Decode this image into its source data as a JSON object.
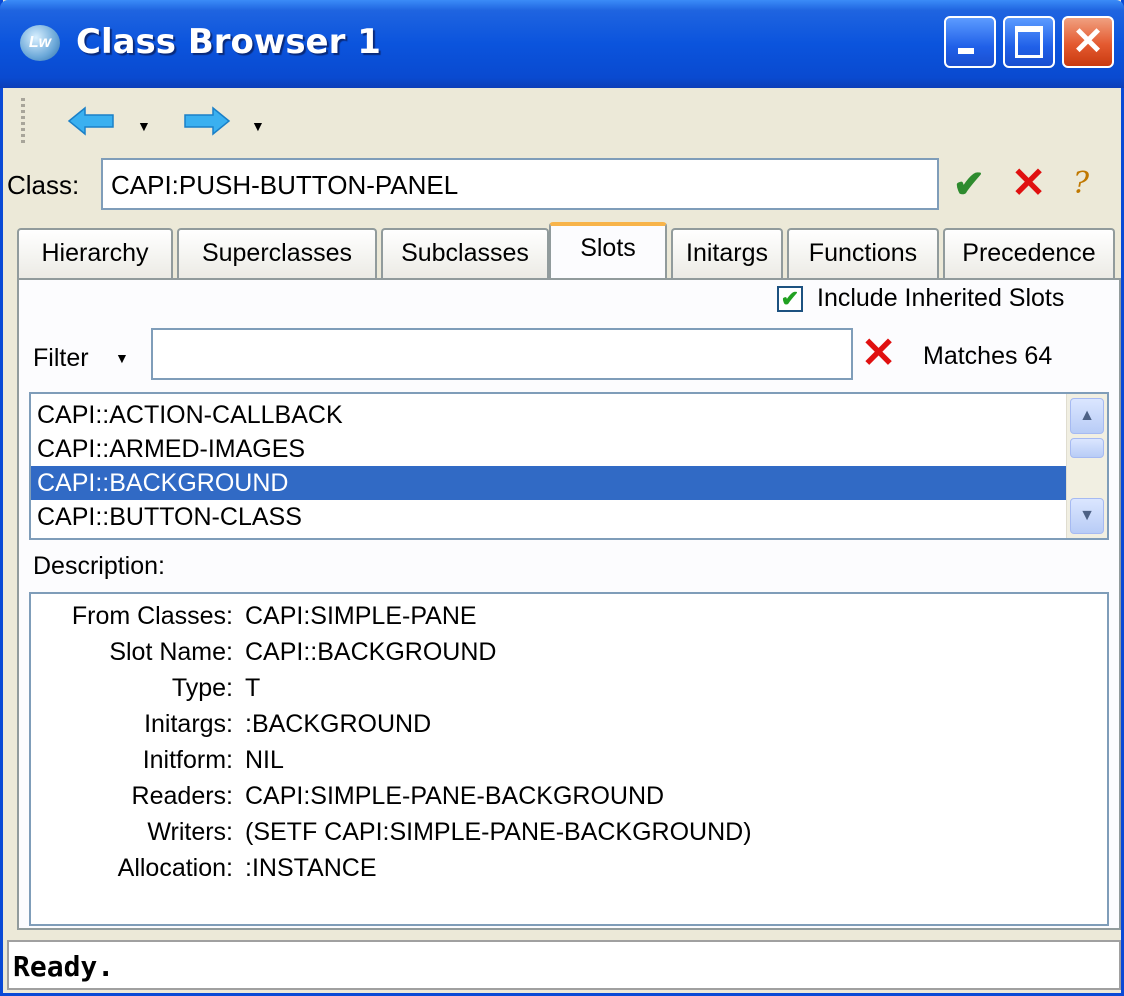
{
  "window": {
    "title": "Class Browser 1",
    "app_icon_text": "Lw"
  },
  "toolbar": {
    "back_icon": "arrow-left-icon",
    "forward_icon": "arrow-right-icon"
  },
  "class_field": {
    "label": "Class:",
    "value": "CAPI:PUSH-BUTTON-PANEL"
  },
  "tabs": [
    "Hierarchy",
    "Superclasses",
    "Subclasses",
    "Slots",
    "Initargs",
    "Functions",
    "Precedence"
  ],
  "active_tab": "Slots",
  "slots": {
    "include_inherited_label": "Include Inherited Slots",
    "include_inherited_checked": true,
    "filter_label": "Filter",
    "filter_value": "",
    "matches_text": "Matches 64",
    "items": [
      "CAPI::ACTION-CALLBACK",
      "CAPI::ARMED-IMAGES",
      "CAPI::BACKGROUND",
      "CAPI::BUTTON-CLASS"
    ],
    "selected_index": 2
  },
  "description": {
    "label": "Description:",
    "rows": [
      {
        "key": "From Classes:",
        "value": "CAPI:SIMPLE-PANE"
      },
      {
        "key": "Slot Name:",
        "value": "CAPI::BACKGROUND"
      },
      {
        "key": "Type:",
        "value": "T"
      },
      {
        "key": "Initargs:",
        "value": ":BACKGROUND"
      },
      {
        "key": "Initform:",
        "value": "NIL"
      },
      {
        "key": "Readers:",
        "value": "CAPI:SIMPLE-PANE-BACKGROUND"
      },
      {
        "key": "Writers:",
        "value": "(SETF CAPI:SIMPLE-PANE-BACKGROUND)"
      },
      {
        "key": "Allocation:",
        "value": ":INSTANCE"
      }
    ]
  },
  "status": {
    "text": "Ready."
  },
  "colors": {
    "title_bar": "#0b54dd",
    "selection": "#316ac5",
    "accept": "#2e8b2e",
    "cancel": "#e01010"
  }
}
